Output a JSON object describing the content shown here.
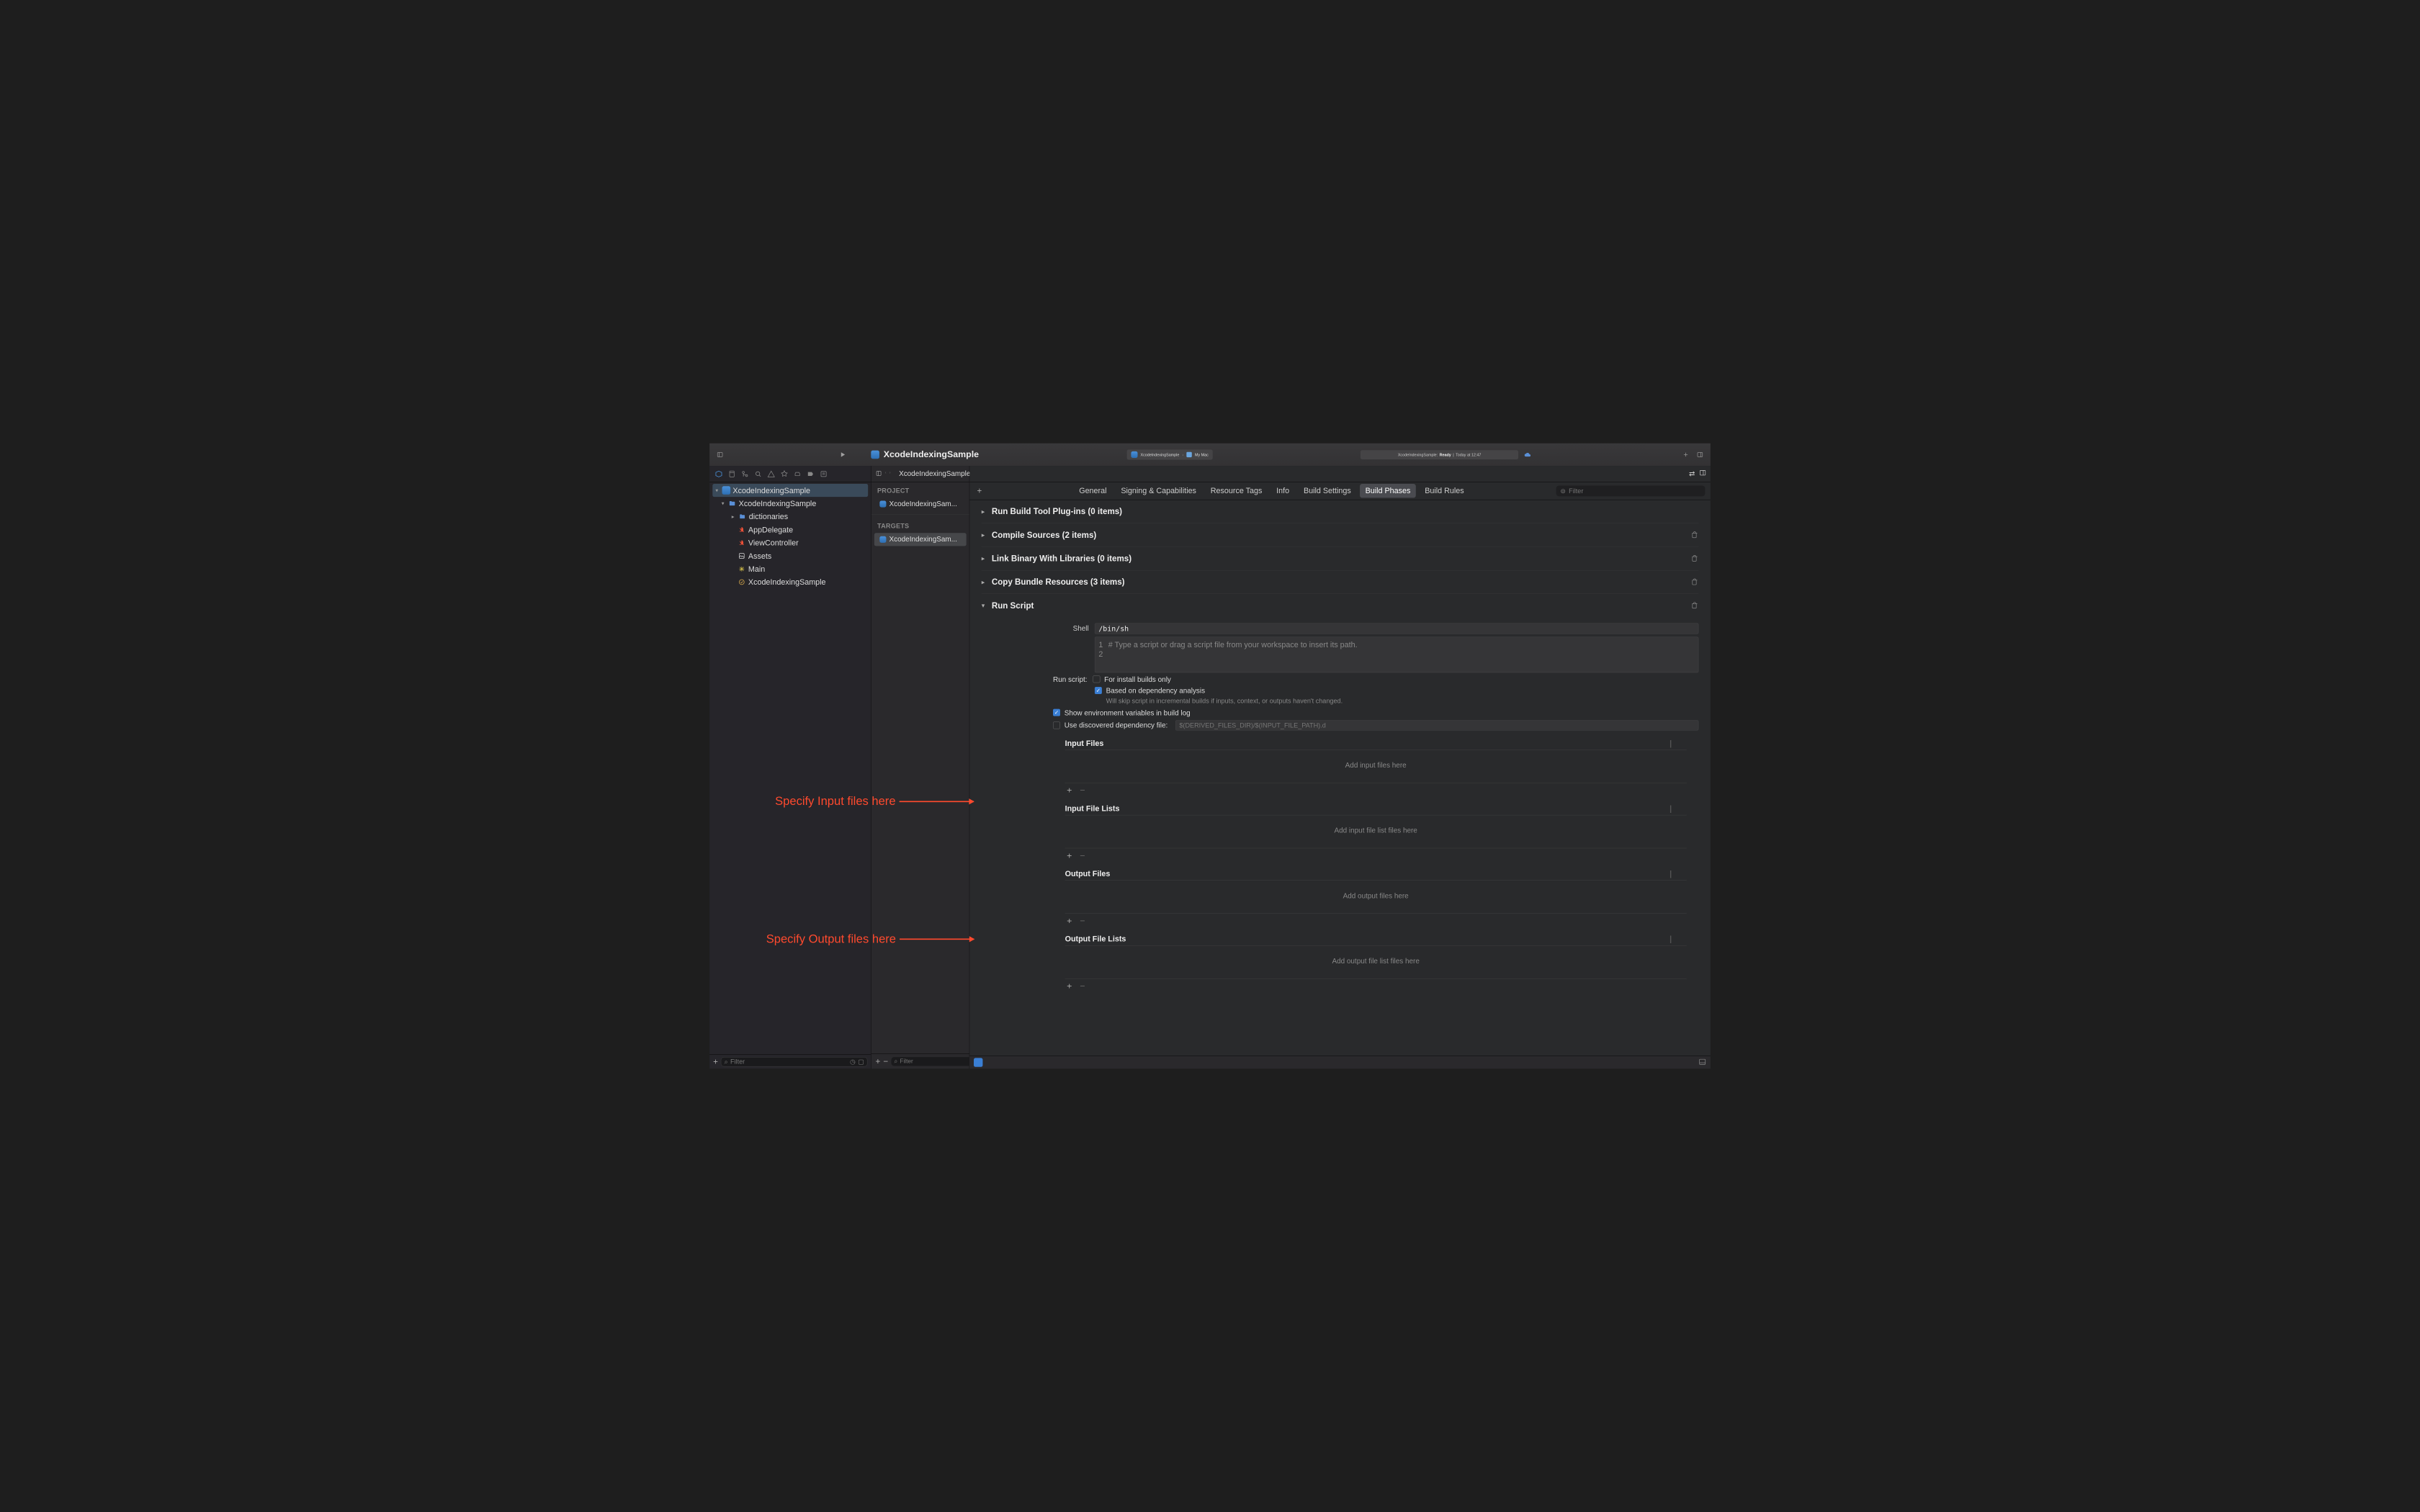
{
  "toolbar": {
    "title": "XcodeIndexingSample",
    "scheme": {
      "project": "XcodeIndexingSample",
      "destination": "My Mac"
    },
    "status": {
      "project": "XcodeIndexingSample:",
      "state": "Ready",
      "sep": "|",
      "when": "Today at 12:47"
    }
  },
  "jumpbar": {
    "project": "XcodeIndexingSample"
  },
  "navigator": {
    "root": "XcodeIndexingSample",
    "group": "XcodeIndexingSample",
    "items": [
      {
        "name": "dictionaries",
        "kind": "folder"
      },
      {
        "name": "AppDelegate",
        "kind": "swift"
      },
      {
        "name": "ViewController",
        "kind": "swift"
      },
      {
        "name": "Assets",
        "kind": "assets"
      },
      {
        "name": "Main",
        "kind": "storyboard"
      },
      {
        "name": "XcodeIndexingSample",
        "kind": "entitlements"
      }
    ],
    "filter_placeholder": "Filter"
  },
  "midcol": {
    "project_label": "PROJECT",
    "project_item": "XcodeIndexingSam...",
    "targets_label": "TARGETS",
    "target_item": "XcodeIndexingSam...",
    "filter_placeholder": "Filter"
  },
  "tabs": {
    "items": [
      "General",
      "Signing & Capabilities",
      "Resource Tags",
      "Info",
      "Build Settings",
      "Build Phases",
      "Build Rules"
    ],
    "active": "Build Phases",
    "filter_placeholder": "Filter"
  },
  "phases": [
    {
      "title": "Run Build Tool Plug-ins (0 items)"
    },
    {
      "title": "Compile Sources (2 items)"
    },
    {
      "title": "Link Binary With Libraries (0 items)"
    },
    {
      "title": "Copy Bundle Resources (3 items)"
    }
  ],
  "run_script": {
    "title": "Run Script",
    "shell_label": "Shell",
    "shell_value": "/bin/sh",
    "script_placeholder": "# Type a script or drag a script file from your workspace to insert its path.",
    "run_script_label": "Run script:",
    "install_only": "For install builds only",
    "dependency": "Based on dependency analysis",
    "dependency_help": "Will skip script in incremental builds if inputs, context, or outputs haven't changed.",
    "show_env": "Show environment variables in build log",
    "use_dep_file": "Use discovered dependency file:",
    "dep_file_placeholder": "$(DERIVED_FILES_DIR)/$(INPUT_FILE_PATH).d",
    "sections": {
      "input_files": {
        "title": "Input Files",
        "placeholder": "Add input files here"
      },
      "input_lists": {
        "title": "Input File Lists",
        "placeholder": "Add input file list files here"
      },
      "output_files": {
        "title": "Output Files",
        "placeholder": "Add output files here"
      },
      "output_lists": {
        "title": "Output File Lists",
        "placeholder": "Add output file list files here"
      }
    }
  },
  "annotations": {
    "input": "Specify Input files here",
    "output": "Specify Output files here"
  }
}
